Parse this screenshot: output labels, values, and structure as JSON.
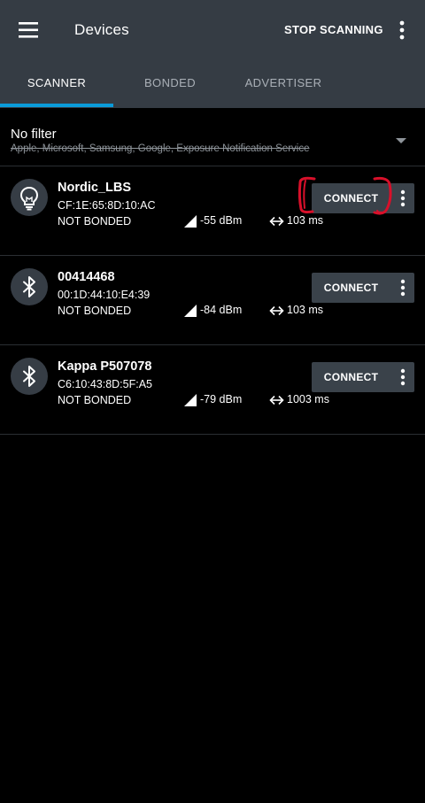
{
  "toolbar": {
    "menu_icon": "hamburger-menu-icon",
    "title": "Devices",
    "stop_label": "STOP SCANNING",
    "overflow_icon": "more-vert-icon"
  },
  "tabs": [
    {
      "label": "SCANNER",
      "active": true
    },
    {
      "label": "BONDED",
      "active": false
    },
    {
      "label": "ADVERTISER",
      "active": false
    }
  ],
  "filter": {
    "title": "No filter",
    "subtitle": "Apple, Microsoft, Samsung, Google, Exposure Notification Service",
    "dropdown_icon": "arrow-drop-down-icon"
  },
  "devices": [
    {
      "name": "Nordic_LBS",
      "address": "CF:1E:65:8D:10:AC",
      "bond_state": "NOT BONDED",
      "rssi": "-55 dBm",
      "interval": "103 ms",
      "icon": "lightbulb-icon",
      "connect_label": "CONNECT"
    },
    {
      "name": "00414468",
      "address": "00:1D:44:10:E4:39",
      "bond_state": "NOT BONDED",
      "rssi": "-84 dBm",
      "interval": "103 ms",
      "icon": "bluetooth-icon",
      "connect_label": "CONNECT"
    },
    {
      "name": "Kappa P507078",
      "address": "C6:10:43:8D:5F:A5",
      "bond_state": "NOT BONDED",
      "rssi": "-79 dBm",
      "interval": "1003 ms",
      "icon": "bluetooth-icon",
      "connect_label": "CONNECT"
    }
  ],
  "colors": {
    "appbar": "#353c44",
    "tab_indicator": "#0a9bd9",
    "button": "#3a424a",
    "annotation": "#d8102a"
  }
}
